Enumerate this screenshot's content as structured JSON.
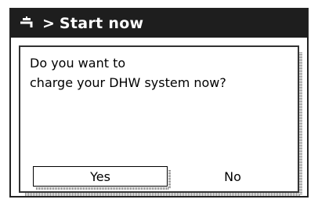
{
  "header": {
    "icon": "tap-icon",
    "separator": ">",
    "title": "Start now"
  },
  "dialog": {
    "message_line1": "Do you want to",
    "message_line2": "charge your DHW system now?",
    "yes_label": "Yes",
    "no_label": "No"
  }
}
